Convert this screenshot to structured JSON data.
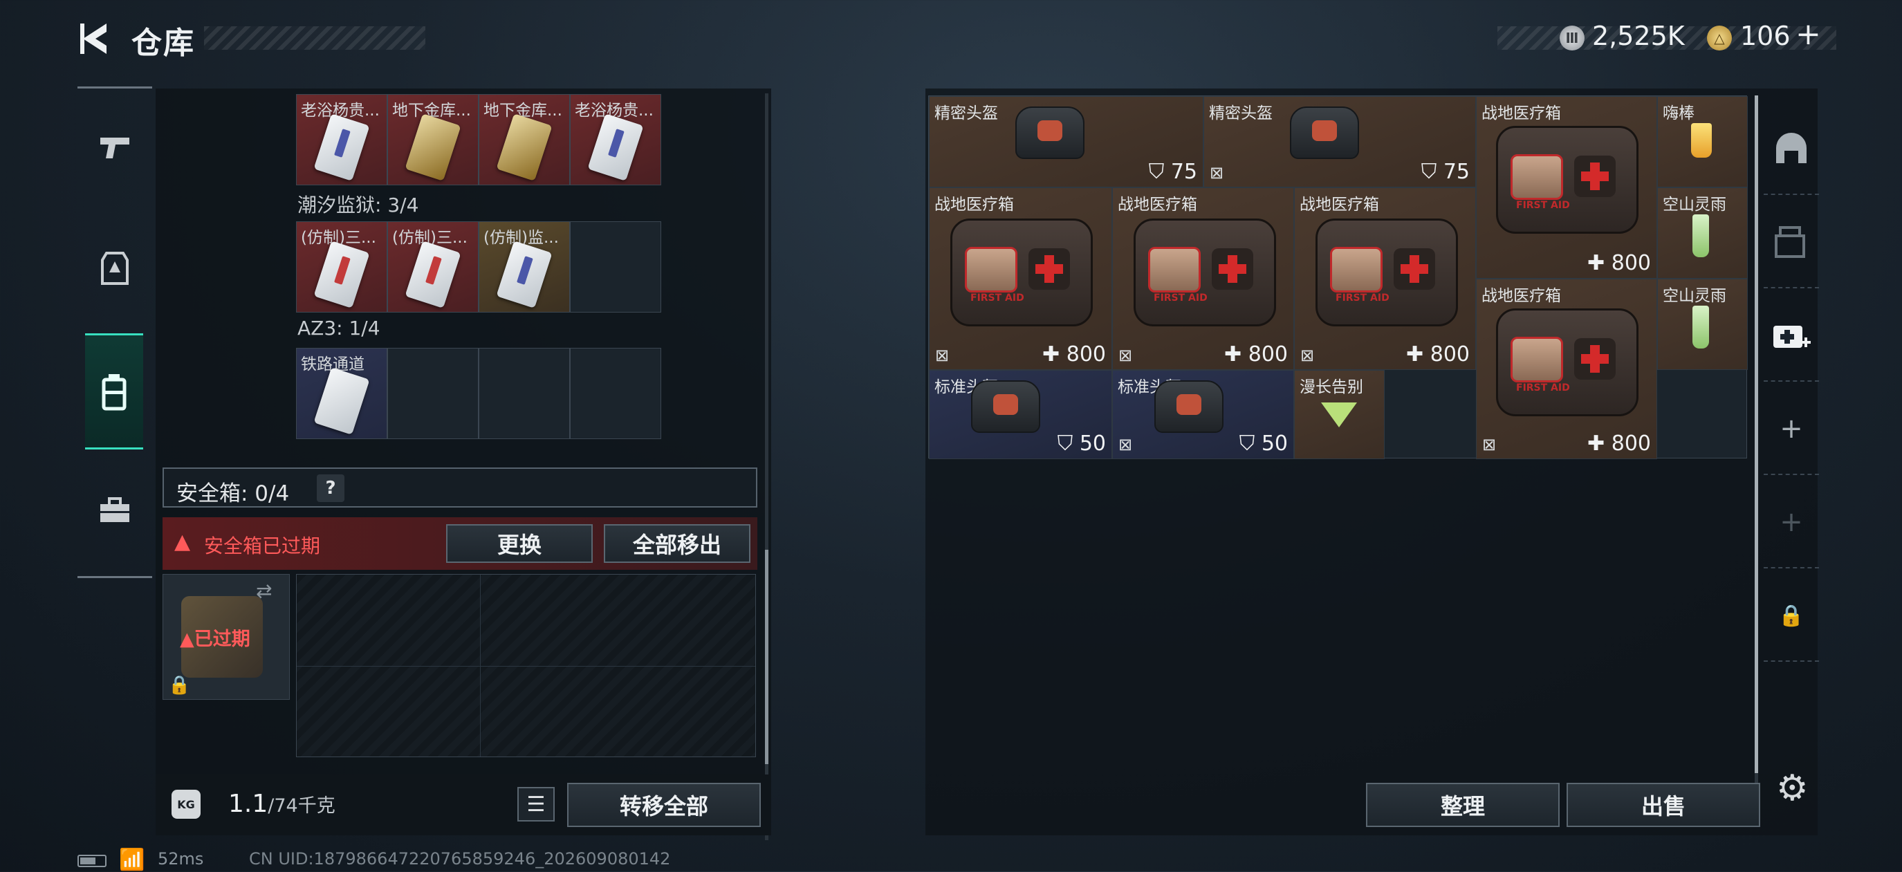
{
  "header": {
    "title": "仓库",
    "back_icon": "chevron-left-icon"
  },
  "currency": {
    "silver": "2,525K",
    "gold": "106",
    "gold_plus": "+",
    "silver_icon": "silver-coin-icon",
    "gold_icon": "gold-coin-icon"
  },
  "left_nav": {
    "items": [
      {
        "name": "pistol-icon"
      },
      {
        "name": "armor-icon"
      },
      {
        "name": "backpack-icon",
        "active": true
      },
      {
        "name": "toolbox-icon"
      }
    ],
    "accent": "#38e0c0"
  },
  "keys": {
    "row1": [
      {
        "name": "老浴杨贵...",
        "color": "red"
      },
      {
        "name": "地下金库...",
        "color": "red"
      },
      {
        "name": "地下金库...",
        "color": "red"
      },
      {
        "name": "老浴杨贵...",
        "color": "red"
      }
    ],
    "group2_label": "潮汐监狱: 3/4",
    "row2": [
      {
        "name": "(仿制)三...",
        "color": "red"
      },
      {
        "name": "(仿制)三...",
        "color": "red"
      },
      {
        "name": "(仿制)监...",
        "color": "gold"
      },
      {
        "name": "",
        "color": "empty"
      }
    ],
    "group3_label": "AZ3: 1/4",
    "row3": [
      {
        "name": "铁路通道",
        "color": "blue"
      },
      {
        "name": "",
        "color": "empty"
      },
      {
        "name": "",
        "color": "empty"
      },
      {
        "name": "",
        "color": "empty"
      }
    ]
  },
  "secure": {
    "label": "安全箱: 0/4",
    "help": "?",
    "expired_warning": "安全箱已过期",
    "replace_button": "更换",
    "move_all_button": "全部移出",
    "case_status": "已过期"
  },
  "weight": {
    "current": "1.1",
    "capacity": "/74千克",
    "kg_icon": "KG"
  },
  "buttons": {
    "transfer_all": "转移全部",
    "sort": "整理",
    "sell": "出售"
  },
  "inventory": {
    "items": [
      {
        "name": "精密头盔",
        "value": "75",
        "type": "helmet",
        "stat": "armor"
      },
      {
        "name": "精密头盔",
        "value": "75",
        "type": "helmet",
        "stat": "armor",
        "no_insure": true
      },
      {
        "name": "战地医疗箱",
        "value": "800",
        "type": "medkit",
        "stat": "heal"
      },
      {
        "name": "嗨棒",
        "type": "drink"
      },
      {
        "name": "战地医疗箱",
        "value": "800",
        "type": "medkit",
        "stat": "heal",
        "no_insure": true
      },
      {
        "name": "战地医疗箱",
        "value": "800",
        "type": "medkit",
        "stat": "heal",
        "no_insure": true
      },
      {
        "name": "战地医疗箱",
        "value": "800",
        "type": "medkit",
        "stat": "heal",
        "no_insure": true
      },
      {
        "name": "空山灵雨",
        "type": "drink"
      },
      {
        "name": "战地医疗箱",
        "value": "800",
        "type": "medkit",
        "stat": "heal",
        "no_insure": true
      },
      {
        "name": "空山灵雨",
        "type": "drink"
      },
      {
        "name": "标准头盔",
        "value": "50",
        "type": "helmet",
        "stat": "armor"
      },
      {
        "name": "标准头盔",
        "value": "50",
        "type": "helmet",
        "stat": "armor",
        "no_insure": true
      },
      {
        "name": "漫长告别",
        "type": "cocktail"
      }
    ]
  },
  "right_tools": [
    {
      "name": "helmet-slot-icon",
      "label": ""
    },
    {
      "name": "crate-icon",
      "label": ""
    },
    {
      "name": "medkit-add-icon",
      "label": ""
    },
    {
      "name": "add-icon",
      "label": "+"
    },
    {
      "name": "add-disabled-icon",
      "label": "+"
    },
    {
      "name": "lock-icon",
      "label": ""
    }
  ],
  "status": {
    "ping": "52ms",
    "uid": "CN UID:1879866472207658592​46_202609080142"
  }
}
